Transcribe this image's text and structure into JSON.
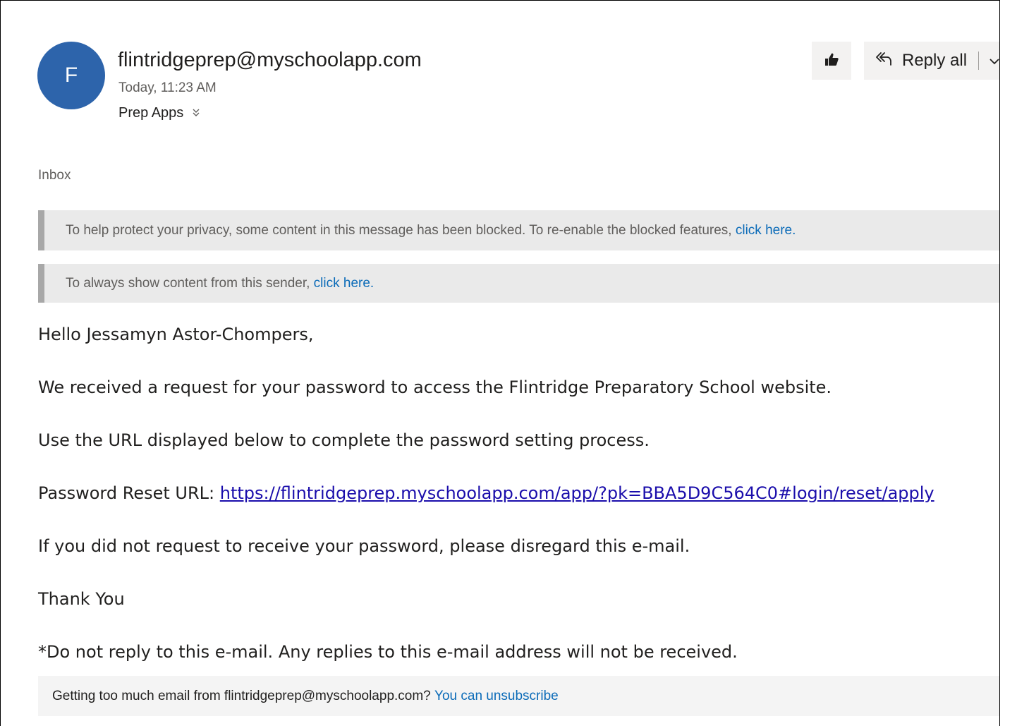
{
  "message": {
    "avatar_initial": "F",
    "sender": "flintridgeprep@myschoolapp.com",
    "datetime": "Today, 11:23 AM",
    "recipient": "Prep Apps",
    "folder": "Inbox"
  },
  "actions": {
    "like_icon": "thumbs-up-icon",
    "reply_all_icon": "reply-all-icon",
    "reply_all_label": "Reply all",
    "more_icon": "chevron-down-icon"
  },
  "notices": {
    "blocked_text": "To help protect your privacy, some content in this message has been blocked. To re-enable the blocked features,",
    "blocked_link": "click here.",
    "sender_text": "To always show content from this sender,",
    "sender_link": "click here."
  },
  "body": {
    "greeting": "Hello Jessamyn Astor-Chompers,",
    "line1": "We received a request for your password to access the Flintridge Preparatory School website.",
    "line2": "Use the URL displayed below to complete the password setting process.",
    "reset_label": "Password Reset URL:",
    "reset_url": "https://flintridgeprep.myschoolapp.com/app/?pk=BBA5D9C564C0#login/reset/apply",
    "line3": "If you did not request to receive your password, please disregard this e-mail.",
    "closing": "Thank You",
    "note": "*Do not reply to this e-mail. Any replies to this e-mail address will not be received."
  },
  "footer": {
    "text": "Getting too much email from flintridgeprep@myschoolapp.com?",
    "link": "You can unsubscribe"
  },
  "colors": {
    "avatar": "#2d64ab",
    "link": "#0b6bb8",
    "reset_link": "#1a0dab",
    "notice_bg": "#eaeaea",
    "notice_bar": "#a8a8a8"
  }
}
